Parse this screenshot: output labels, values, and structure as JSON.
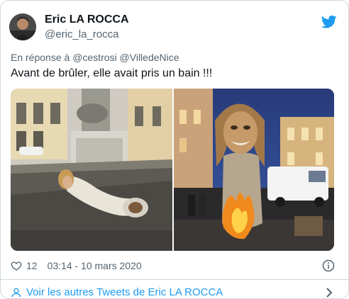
{
  "author": {
    "name": "Eric LA ROCCA",
    "handle": "@eric_la_rocca",
    "avatar_icon": "profile-photo"
  },
  "reply": {
    "prefix": "En réponse à",
    "mentions": [
      "@cestrosi",
      "@VilledeNice"
    ]
  },
  "tweet": {
    "text": "Avant de brûler, elle avait pris un bain !!!"
  },
  "media": {
    "photos": [
      {
        "icon": "photo-statue-in-fountain"
      },
      {
        "icon": "photo-burning-effigy"
      }
    ]
  },
  "stats": {
    "likes": "12",
    "timestamp": "03:14 - 10 mars 2020"
  },
  "footer": {
    "more_tweets": "Voir les autres Tweets de Eric LA ROCCA"
  },
  "colors": {
    "accent": "#1d9bf0",
    "text_secondary": "#536471",
    "border": "#cfd9de"
  }
}
